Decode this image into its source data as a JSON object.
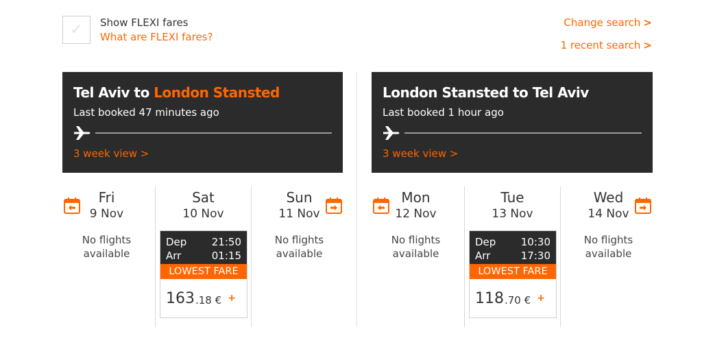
{
  "flexi": {
    "checkbox_icon": "check-icon",
    "label": "Show FLEXI fares",
    "link": "What are FLEXI fares?"
  },
  "top_links": {
    "change_search": "Change search",
    "recent_search": "1 recent search",
    "caret": ">"
  },
  "outbound": {
    "title_from": "Tel Aviv to",
    "title_to": "London Stansted",
    "last_booked": "Last booked 47 minutes ago",
    "week_view": "3 week view >",
    "days": [
      {
        "name": "Fri",
        "date": "9 Nov",
        "status": "No flights available"
      },
      {
        "name": "Sat",
        "date": "10 Nov",
        "dep_label": "Dep",
        "dep": "21:50",
        "arr_label": "Arr",
        "arr": "01:15",
        "badge": "LOWEST FARE",
        "price_int": "163",
        "price_dec": ".18 €",
        "add": "+"
      },
      {
        "name": "Sun",
        "date": "11 Nov",
        "status": "No flights available"
      }
    ]
  },
  "return": {
    "title": "London Stansted to Tel Aviv",
    "last_booked": "Last booked 1 hour ago",
    "week_view": "3 week view >",
    "days": [
      {
        "name": "Mon",
        "date": "12 Nov",
        "status": "No flights available"
      },
      {
        "name": "Tue",
        "date": "13 Nov",
        "dep_label": "Dep",
        "dep": "10:30",
        "arr_label": "Arr",
        "arr": "17:30",
        "badge": "LOWEST FARE",
        "price_int": "118",
        "price_dec": ".70 €",
        "add": "+"
      },
      {
        "name": "Wed",
        "date": "14 Nov",
        "status": "No flights available"
      }
    ]
  },
  "colors": {
    "accent": "#ff6600",
    "card": "#2b2b2b"
  }
}
